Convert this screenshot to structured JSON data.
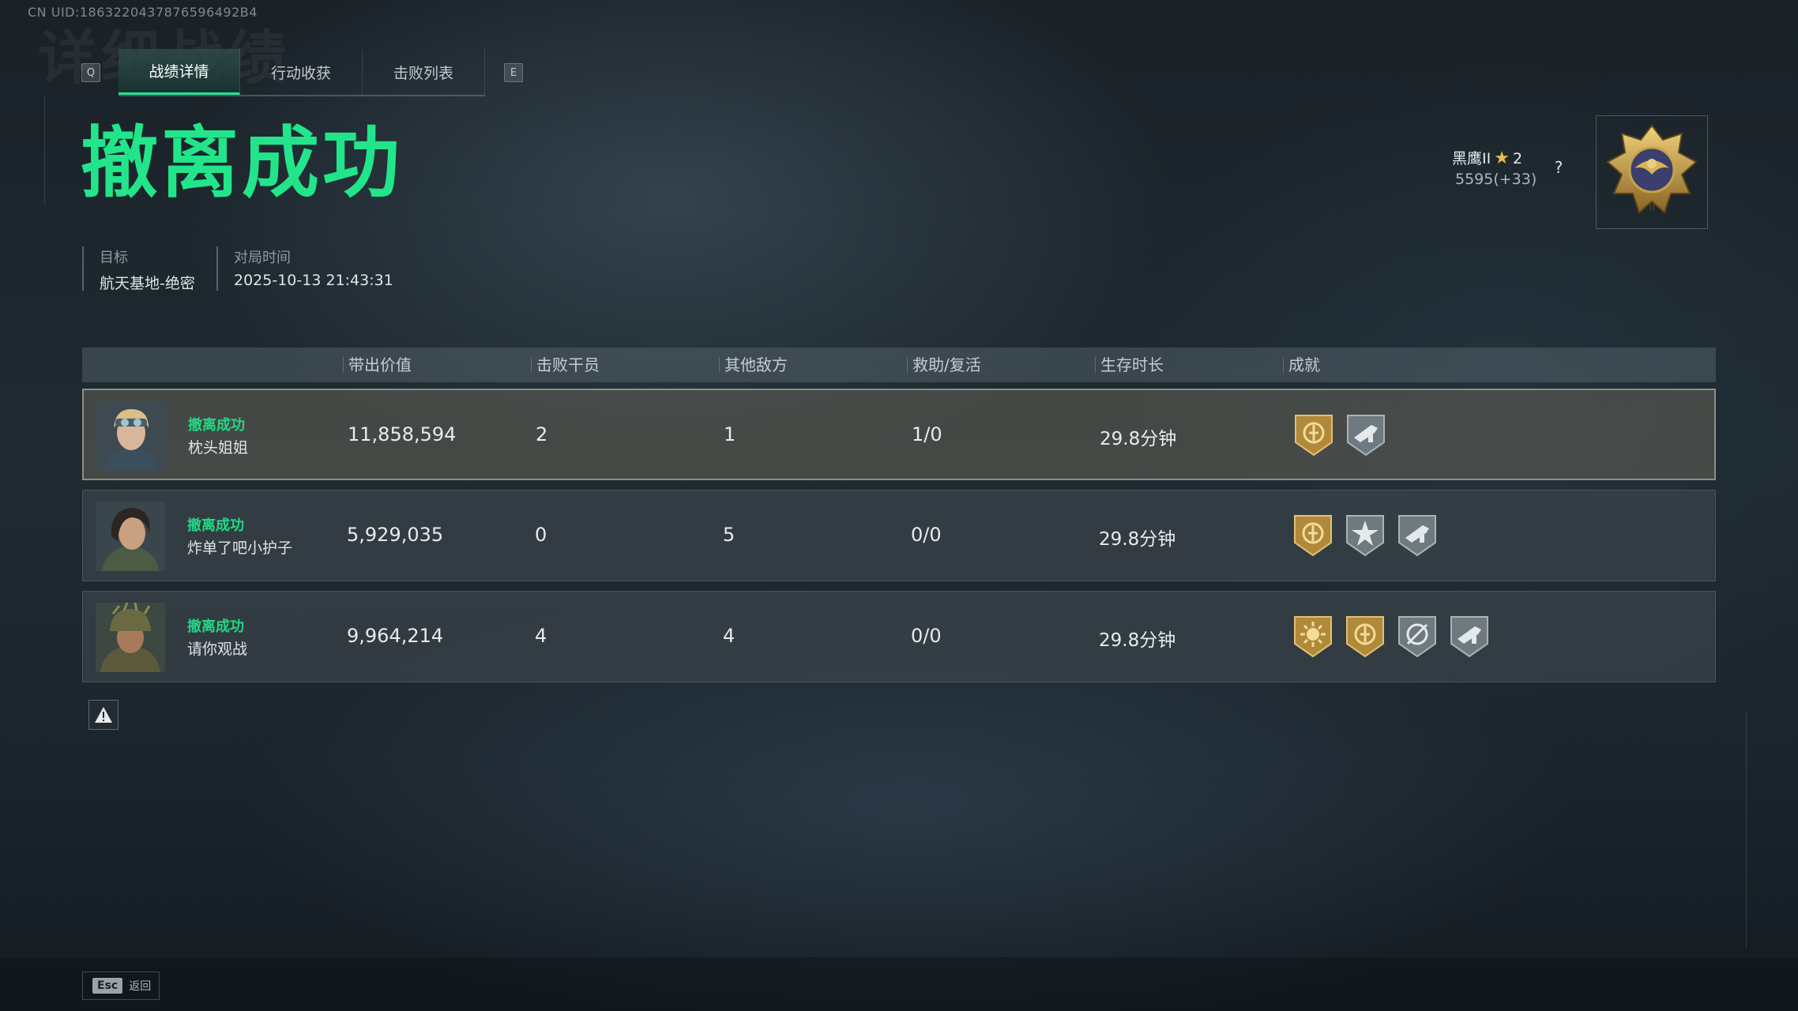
{
  "uid_label": "CN UID:1863220437876596492B4",
  "ghost_title": "详细战绩",
  "tabs": {
    "left_key": "Q",
    "right_key": "E",
    "items": [
      {
        "label": "战绩详情",
        "active": true
      },
      {
        "label": "行动收获",
        "active": false
      },
      {
        "label": "击败列表",
        "active": false
      }
    ]
  },
  "result_title": "撤离成功",
  "target": {
    "label": "目标",
    "value": "航天基地-绝密"
  },
  "match_time": {
    "label": "对局时间",
    "value": "2025-10-13 21:43:31"
  },
  "rank": {
    "name": "黑鹰II",
    "stars": "2",
    "score": "5595(+33)",
    "help": "?"
  },
  "columns": [
    "带出价值",
    "击败干员",
    "其他敌方",
    "救助/复活",
    "生存时长",
    "成就"
  ],
  "players": [
    {
      "status": "撤离成功",
      "name": "枕头姐姐",
      "value": "11,858,594",
      "kills": "2",
      "other": "1",
      "assist": "1/0",
      "survival": "29.8分钟",
      "badges": [
        "gold-medal-icon",
        "silver-weapon-icon"
      ],
      "highlight": true
    },
    {
      "status": "撤离成功",
      "name": "炸单了吧小护子",
      "value": "5,929,035",
      "kills": "0",
      "other": "5",
      "assist": "0/0",
      "survival": "29.8分钟",
      "badges": [
        "gold-medal-icon",
        "silver-star-icon",
        "silver-weapon-icon"
      ],
      "highlight": false
    },
    {
      "status": "撤离成功",
      "name": "请你观战",
      "value": "9,964,214",
      "kills": "4",
      "other": "4",
      "assist": "0/0",
      "survival": "29.8分钟",
      "badges": [
        "gold-sun-icon",
        "gold-medal-icon",
        "silver-target-icon",
        "silver-weapon-icon"
      ],
      "highlight": false
    }
  ],
  "footer": {
    "esc_key": "Esc",
    "esc_label": "返回"
  },
  "colors": {
    "accent": "#22e58b",
    "gold": "#c9a347",
    "silver": "#8b969c"
  }
}
